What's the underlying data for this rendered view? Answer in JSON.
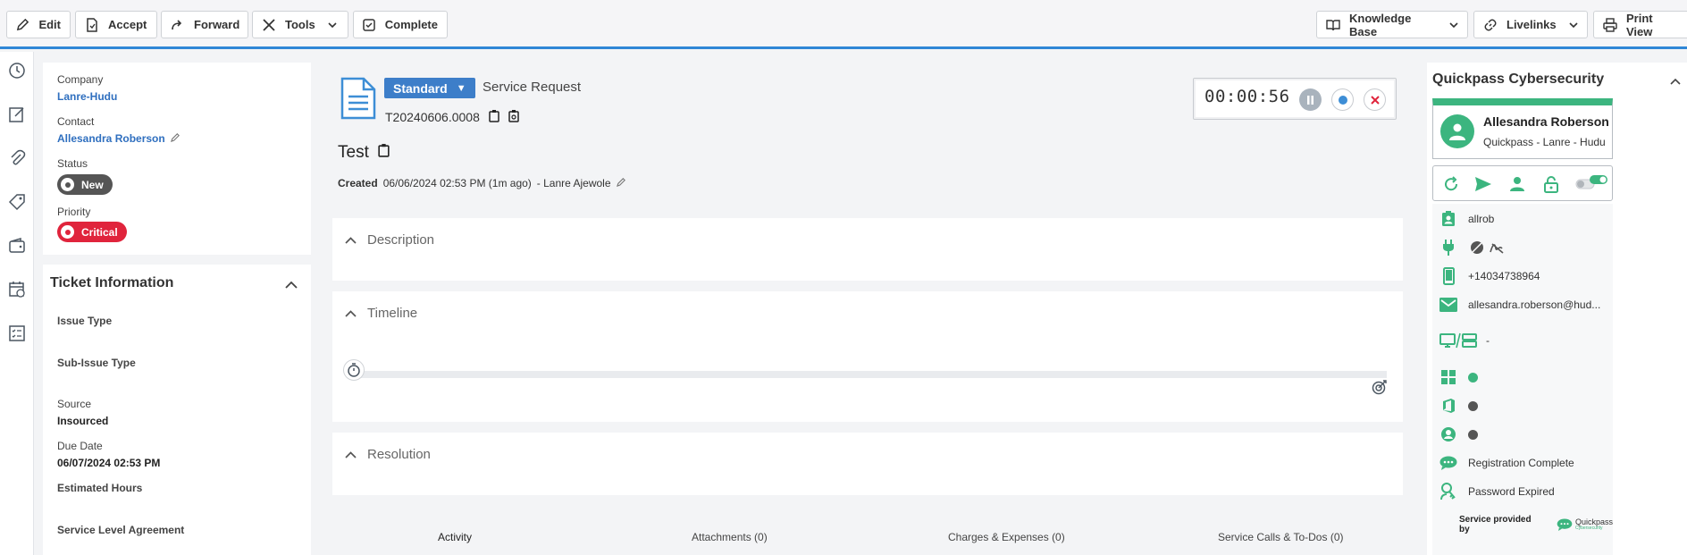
{
  "toolbar": {
    "edit": "Edit",
    "accept": "Accept",
    "forward": "Forward",
    "tools": "Tools",
    "complete": "Complete",
    "knowledge_base": "Knowledge Base",
    "livelinks": "Livelinks",
    "print_view": "Print View"
  },
  "summary": {
    "company_label": "Company",
    "company": "Lanre-Hudu",
    "contact_label": "Contact",
    "contact": "Allesandra Roberson",
    "status_label": "Status",
    "status": "New",
    "priority_label": "Priority",
    "priority": "Critical"
  },
  "ticket_info": {
    "title": "Ticket Information",
    "issue_type_label": "Issue Type",
    "sub_issue_type_label": "Sub-Issue Type",
    "source_label": "Source",
    "source": "Insourced",
    "due_date_label": "Due Date",
    "due_date": "06/07/2024 02:53 PM",
    "estimated_hours_label": "Estimated Hours",
    "sla_label": "Service Level Agreement"
  },
  "ticket": {
    "category": "Standard",
    "type": "Service Request",
    "number": "T20240606.0008",
    "title": "Test",
    "created_label": "Created",
    "created": "06/06/2024 02:53 PM (1m ago)",
    "created_by": "- Lanre Ajewole"
  },
  "timer": {
    "value": "00:00:56"
  },
  "sections": {
    "description": "Description",
    "timeline": "Timeline",
    "resolution": "Resolution"
  },
  "tabs": [
    "Activity",
    "Attachments (0)",
    "Charges & Expenses (0)",
    "Service Calls & To-Dos (0)"
  ],
  "quickpass": {
    "title": "Quickpass Cybersecurity",
    "contact_name": "Allesandra Roberson",
    "contact_company": "Quickpass - Lanre - Hudu",
    "username": "allrob",
    "phone": "+14034738964",
    "email": "allesandra.roberson@hud...",
    "devices": "-",
    "registration": "Registration Complete",
    "password": "Password Expired",
    "service_by": "Service provided by",
    "brand": "Quickpass",
    "brand_sub": "Cybersecurity"
  },
  "colors": {
    "accent": "#2f86d6",
    "green": "#3cb57f",
    "critical": "#e0243c",
    "new": "#555555"
  }
}
